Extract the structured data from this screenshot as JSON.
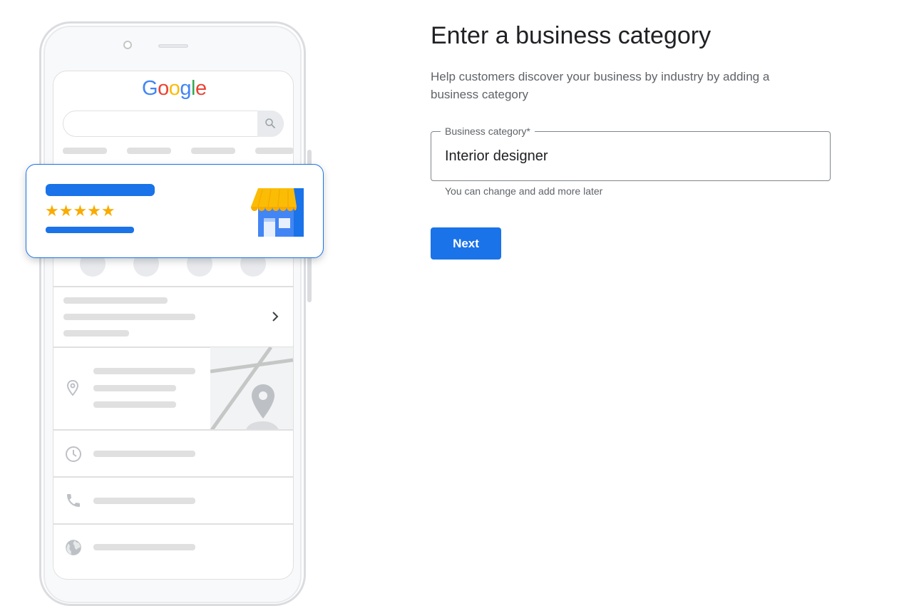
{
  "illustration": {
    "logo_letters": [
      {
        "char": "G",
        "color": "#4285f4"
      },
      {
        "char": "o",
        "color": "#ea4335"
      },
      {
        "char": "o",
        "color": "#fbbc05"
      },
      {
        "char": "g",
        "color": "#4285f4"
      },
      {
        "char": "l",
        "color": "#34a853"
      },
      {
        "char": "e",
        "color": "#ea4335"
      }
    ],
    "stars": "★★★★★",
    "star_color": "#f9ab00",
    "accent": "#1a73e8",
    "icons": [
      "search-icon",
      "phone-icon",
      "directions-icon",
      "bookmark-icon",
      "globe-icon",
      "chevron-right-icon",
      "location-pin-icon",
      "clock-icon",
      "storefront-icon"
    ]
  },
  "form": {
    "title": "Enter a business category",
    "subtitle": "Help customers discover your business by industry by adding a business category",
    "field_label": "Business category*",
    "field_value": "Interior designer",
    "helper_text": "You can change and add more later",
    "next_label": "Next"
  }
}
